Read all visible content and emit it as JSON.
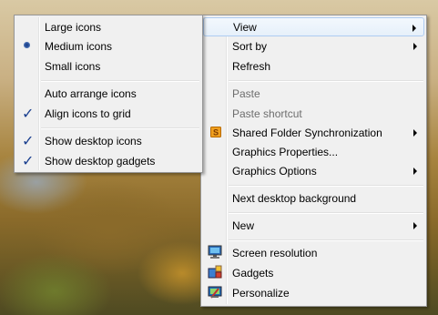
{
  "main_menu": {
    "items": [
      {
        "label": "View",
        "submenu": true,
        "highlight": true
      },
      {
        "label": "Sort by",
        "submenu": true
      },
      {
        "label": "Refresh"
      },
      {
        "label": "Paste",
        "disabled": true
      },
      {
        "label": "Paste shortcut",
        "disabled": true
      },
      {
        "label": "Shared Folder Synchronization",
        "submenu": true,
        "icon": "sync-folder-icon"
      },
      {
        "label": "Graphics Properties..."
      },
      {
        "label": "Graphics Options",
        "submenu": true
      },
      {
        "label": "Next desktop background"
      },
      {
        "label": "New",
        "submenu": true
      },
      {
        "label": "Screen resolution",
        "icon": "screen-resolution-icon"
      },
      {
        "label": "Gadgets",
        "icon": "gadgets-icon"
      },
      {
        "label": "Personalize",
        "icon": "personalize-icon"
      }
    ]
  },
  "view_submenu": {
    "items": [
      {
        "label": "Large icons"
      },
      {
        "label": "Medium icons",
        "mark": "radio"
      },
      {
        "label": "Small icons"
      },
      {
        "label": "Auto arrange icons"
      },
      {
        "label": "Align icons to grid",
        "mark": "check"
      },
      {
        "label": "Show desktop icons",
        "mark": "check"
      },
      {
        "label": "Show desktop gadgets",
        "mark": "check"
      }
    ]
  },
  "colors": {
    "highlight_border": "#aeccf1",
    "menu_bg": "#f0f0f0",
    "disabled_text": "#6d6d6d"
  }
}
